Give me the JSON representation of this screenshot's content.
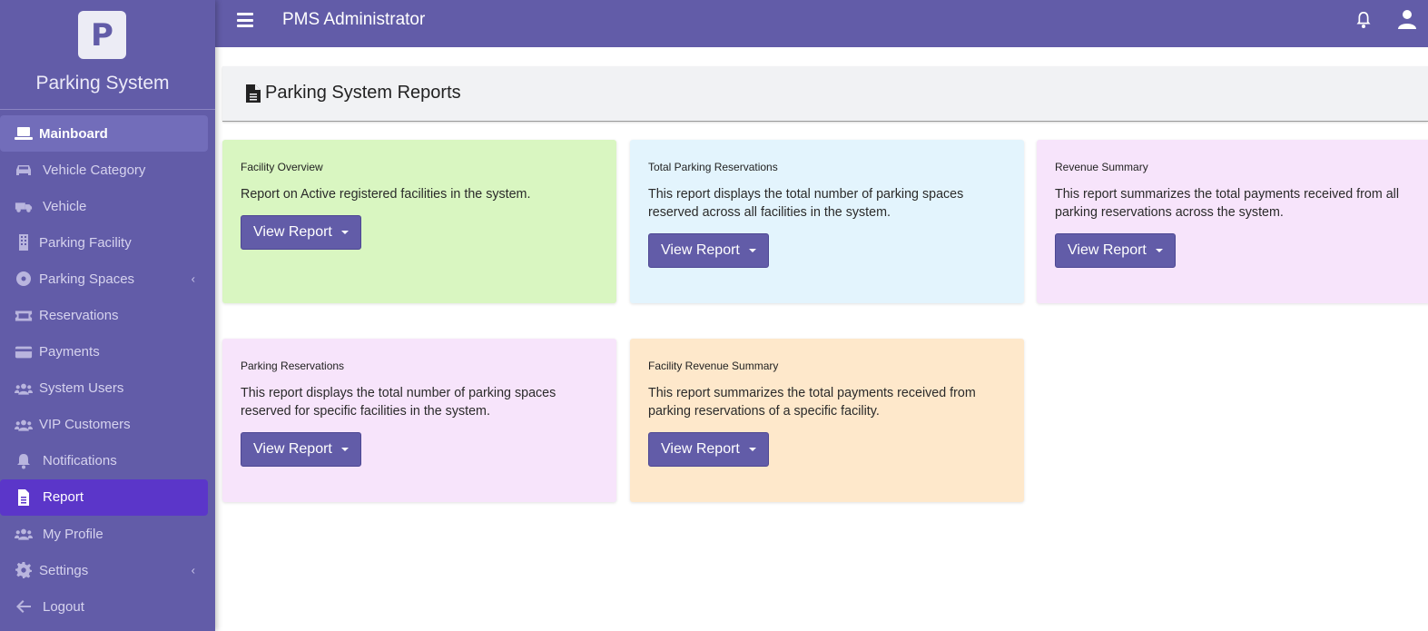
{
  "brand": {
    "logo_letter": "P",
    "name": "Parking System"
  },
  "topbar": {
    "title": "PMS Administrator"
  },
  "sidebar": {
    "items": [
      {
        "label": "Mainboard",
        "icon": "laptop-icon"
      },
      {
        "label": "Vehicle Category",
        "icon": "car-icon"
      },
      {
        "label": "Vehicle",
        "icon": "truck-icon"
      },
      {
        "label": "Parking Facility",
        "icon": "building-icon"
      },
      {
        "label": "Parking Spaces",
        "icon": "disc-icon",
        "chevron": "‹"
      },
      {
        "label": "Reservations",
        "icon": "ticket-icon"
      },
      {
        "label": "Payments",
        "icon": "credit-card-icon"
      },
      {
        "label": "System Users",
        "icon": "users-icon"
      },
      {
        "label": "VIP Customers",
        "icon": "users-icon"
      },
      {
        "label": "Notifications",
        "icon": "bell-icon"
      },
      {
        "label": "Report",
        "icon": "file-icon"
      },
      {
        "label": "My Profile",
        "icon": "users-icon"
      },
      {
        "label": "Settings",
        "icon": "gear-icon",
        "chevron": "‹"
      },
      {
        "label": "Logout",
        "icon": "arrow-left-icon"
      }
    ]
  },
  "page": {
    "title": "Parking System Reports"
  },
  "cards": [
    {
      "title": "Facility Overview",
      "text": "Report on Active registered facilities in the system.",
      "button": "View Report"
    },
    {
      "title": "Total Parking Reservations",
      "text": "This report displays the total number of parking spaces reserved across all facilities in the system.",
      "button": "View Report"
    },
    {
      "title": "Revenue Summary",
      "text": "This report summarizes the total payments received from all parking reservations across the system.",
      "button": "View Report"
    },
    {
      "title": "Parking Reservations",
      "text": "This report displays the total number of parking spaces reserved for specific facilities in the system.",
      "button": "View Report"
    },
    {
      "title": "Facility Revenue Summary",
      "text": "This report summarizes the total payments received from parking reservations of a specific facility.",
      "button": "View Report"
    }
  ],
  "colors": {
    "primary": "#625ca8",
    "active_nav": "#5b36c9",
    "card_green": "#d9f6c1",
    "card_blue": "#e3f4fd",
    "card_pink": "#f7e4fb",
    "card_orange": "#fee8cb"
  }
}
